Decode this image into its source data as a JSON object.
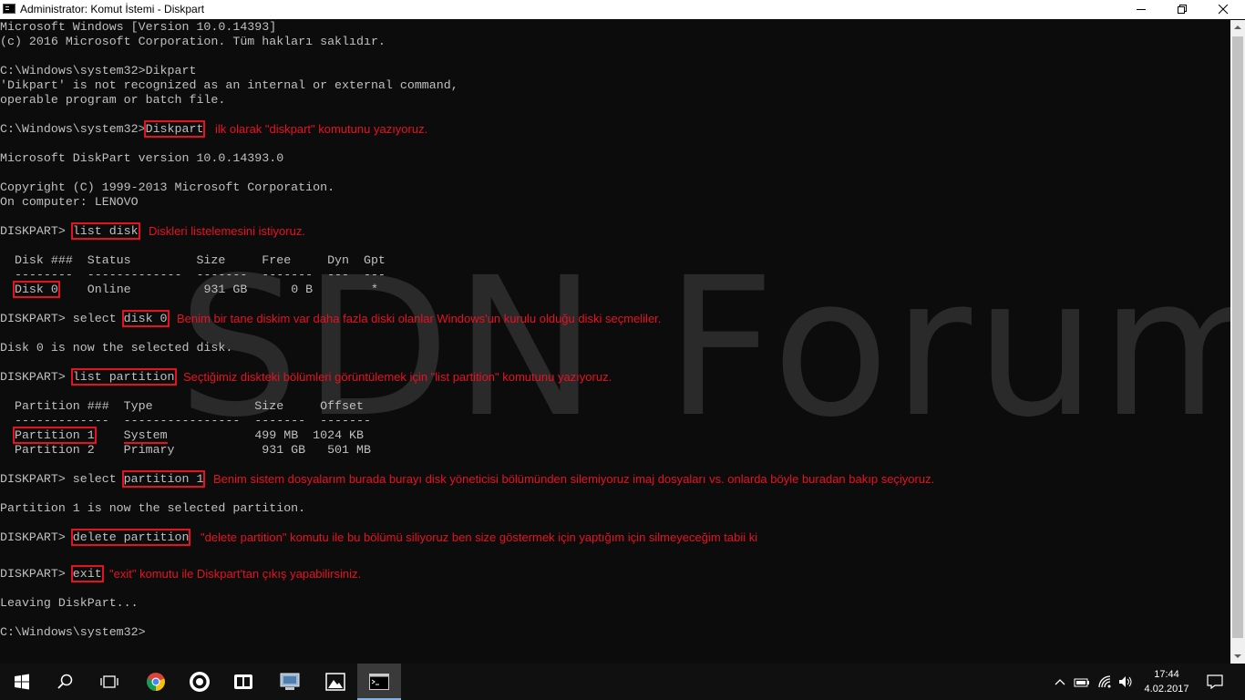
{
  "window": {
    "title": "Administrator: Komut İstemi - Diskpart"
  },
  "console": {
    "lines": [
      "Microsoft Windows [Version 10.0.14393]",
      "(c) 2016 Microsoft Corporation. Tüm hakları saklıdır.",
      "",
      "C:\\Windows\\system32>Dikpart",
      "'Dikpart' is not recognized as an internal or external command,",
      "operable program or batch file.",
      "",
      "C:\\Windows\\system32>",
      "",
      "Microsoft DiskPart version 10.0.14393.0",
      "",
      "Copyright (C) 1999-2013 Microsoft Corporation.",
      "On computer: LENOVO",
      "",
      "DISKPART> ",
      "",
      "  Disk ###  Status         Size     Free     Dyn  Gpt",
      "  --------  -------------  -------  -------  ---  ---",
      "",
      "",
      "DISKPART> select ",
      "",
      "Disk 0 is now the selected disk.",
      "",
      "DISKPART> ",
      "",
      "  Partition ###  Type              Size     Offset",
      "  -------------  ----------------  -------  -------",
      "",
      "  Partition 2    Primary            931 GB   501 MB",
      "",
      "DISKPART> select ",
      "",
      "Partition 1 is now the selected partition.",
      "",
      "DISKPART> ",
      "",
      "DISKPART> ",
      "",
      "Leaving DiskPart...",
      "",
      "C:\\Windows\\system32>"
    ],
    "cmd_diskpart": "Diskpart",
    "cmd_list_disk": "list disk",
    "disk0_label": "Disk 0",
    "disk0_rest": "    Online          931 GB      0 B        *",
    "cmd_disk0": "disk 0",
    "cmd_list_partition": "list partition",
    "partition1_label": "Partition 1",
    "partition1_gap": "    ",
    "partition1_type": "System",
    "partition1_rest": "            499 MB  1024 KB",
    "cmd_partition1": "partition 1",
    "cmd_delete_partition": "delete partition",
    "cmd_exit": "exit"
  },
  "annotations": {
    "diskpart": "ilk olarak \"diskpart\" komutunu yazıyoruz.",
    "list_disk": "Diskleri listelemesini istiyoruz.",
    "select_disk": "Benim bir tane diskim var daha fazla diski olanlar Windows'un kurulu olduğu diski seçmeliler.",
    "list_partition": "Seçtiğimiz diskteki bölümleri görüntülemek için \"list partition\" komutunu yazıyoruz.",
    "select_partition": "Benim sistem dosyalarım burada burayı disk yöneticisi bölümünden silemiyoruz imaj dosyaları vs. onlarda böyle buradan bakıp seçiyoruz.",
    "delete_partition": "\"delete partition\" komutu ile bu bölümü siliyoruz ben size göstermek için yaptığım için silmeyeceğim tabii ki",
    "exit": "\"exit\" komutu ile Diskpart'tan çıkış yapabilirsiniz."
  },
  "watermark": "SDN Forum",
  "taskbar": {
    "icons": [
      "windows-start-icon",
      "search-icon",
      "task-view-icon",
      "chrome-icon",
      "media-player-icon",
      "notes-app-icon",
      "control-panel-icon",
      "photos-icon",
      "command-prompt-icon"
    ],
    "tray_icons": [
      "chevron-up-icon",
      "battery-icon",
      "wifi-icon",
      "volume-icon",
      "notification-icon"
    ],
    "time": "17:44",
    "date": "4.02.2017"
  },
  "colors": {
    "annotation": "#e81123",
    "console_bg": "#0c0c0c",
    "console_text": "#c0c0c0"
  }
}
